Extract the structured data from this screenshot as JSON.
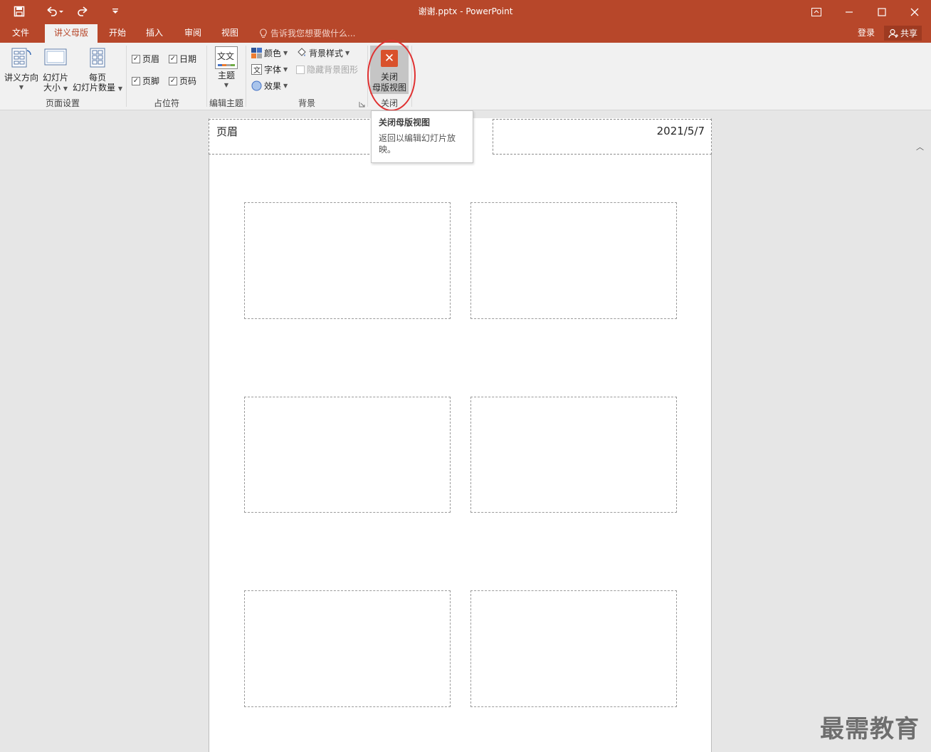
{
  "title_bar": {
    "title": "谢谢.pptx - PowerPoint",
    "qat": [
      "save-icon",
      "undo-icon",
      "redo-icon",
      "customize-icon"
    ],
    "window_controls": [
      "ribbon-display-icon",
      "minimize-icon",
      "maximize-icon",
      "close-icon"
    ]
  },
  "tabs": [
    {
      "label": "文件"
    },
    {
      "label": "讲义母版",
      "active": true
    },
    {
      "label": "开始"
    },
    {
      "label": "插入"
    },
    {
      "label": "审阅"
    },
    {
      "label": "视图"
    }
  ],
  "tell_me": "告诉我您想要做什么...",
  "account": {
    "login": "登录",
    "share": "共享"
  },
  "ribbon": {
    "page_setup": {
      "label": "页面设置",
      "handout_orientation": [
        "讲义方向"
      ],
      "slide_size": [
        "幻灯片",
        "大小"
      ],
      "slides_per_page": [
        "每页",
        "幻灯片数量"
      ]
    },
    "placeholders": {
      "label": "占位符",
      "items": [
        {
          "label": "页眉",
          "checked": true
        },
        {
          "label": "日期",
          "checked": true
        },
        {
          "label": "页脚",
          "checked": true
        },
        {
          "label": "页码",
          "checked": true
        }
      ]
    },
    "edit_theme": {
      "label": "编辑主题",
      "theme_button": "主题",
      "theme_icon_text": "文文"
    },
    "background": {
      "label": "背景",
      "colors": "颜色",
      "fonts": "字体",
      "effects": "效果",
      "bg_styles": "背景样式",
      "hide_bg": "隐藏背景图形"
    },
    "close": {
      "label": "关闭",
      "button": [
        "关闭",
        "母版视图"
      ]
    }
  },
  "tooltip": {
    "title": "关闭母版视图",
    "body": "返回以编辑幻灯片放映。"
  },
  "canvas": {
    "header": "页眉",
    "date": "2021/5/7",
    "slide_count": 6
  },
  "watermark": "最需教育",
  "colors": {
    "accent": "#b7472a",
    "ribbon_bg": "#f1f1f1",
    "canvas_bg": "#e6e6e6",
    "close_icon": "#d9512c",
    "highlight": "#e03131"
  }
}
